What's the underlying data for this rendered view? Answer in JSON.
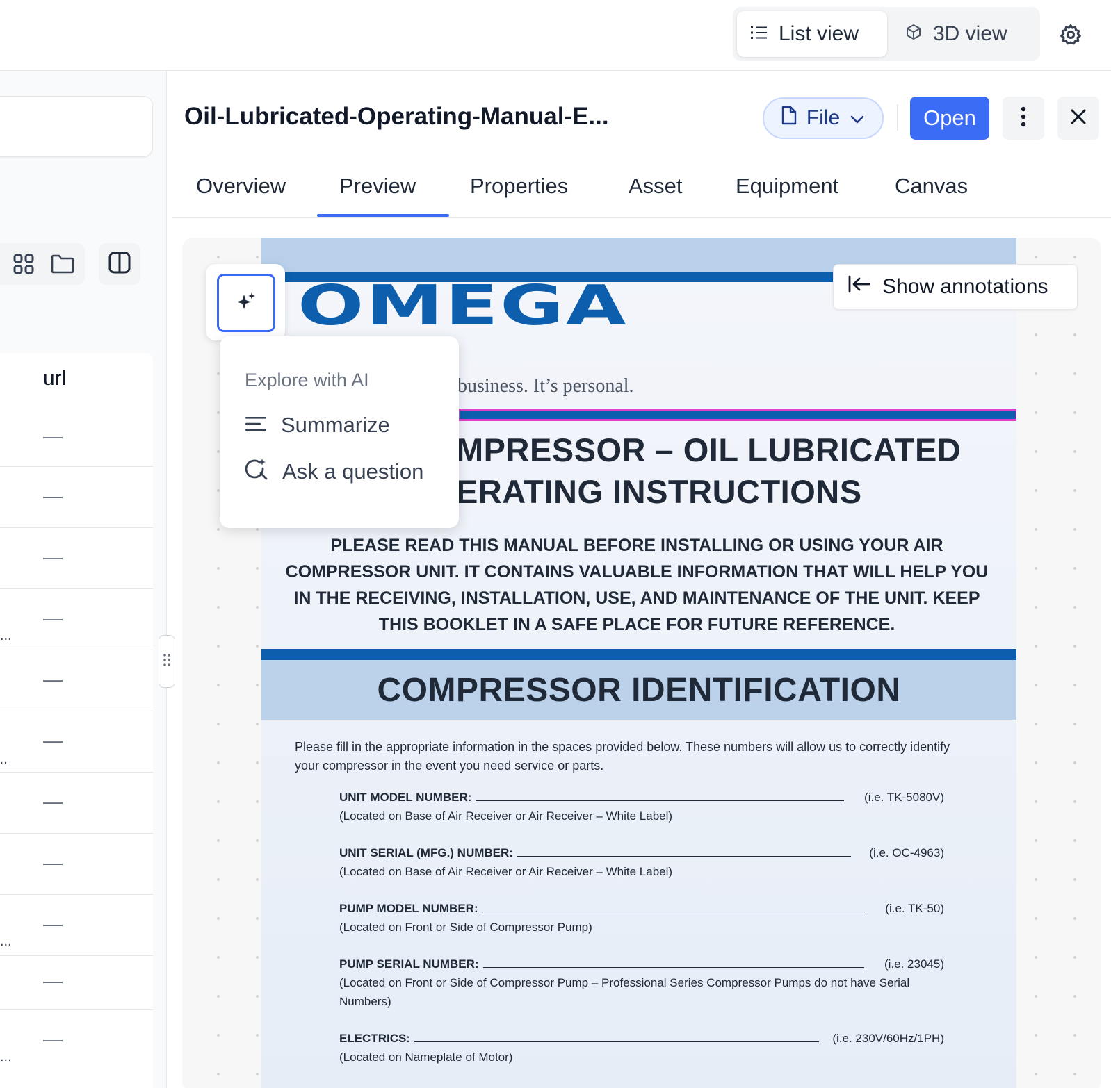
{
  "topbar": {
    "list_view_label": "List view",
    "view3d_label": "3D view"
  },
  "left_panel": {
    "column_header": "url",
    "rows": [
      "—",
      "—",
      "—",
      "—",
      "—",
      "—",
      "—",
      "—",
      "—",
      "—",
      "—"
    ],
    "truncation": "..."
  },
  "document": {
    "title": "Oil-Lubricated-Operating-Manual-E...",
    "file_label": "File",
    "open_label": "Open"
  },
  "tabs": [
    {
      "label": "Overview"
    },
    {
      "label": "Preview"
    },
    {
      "label": "Properties"
    },
    {
      "label": "Asset"
    },
    {
      "label": "Equipment"
    },
    {
      "label": "Canvas"
    }
  ],
  "active_tab": "Preview",
  "ai_menu": {
    "heading": "Explore with AI",
    "summarize": "Summarize",
    "ask": "Ask a question"
  },
  "annotations_label": "Show annotations",
  "manual": {
    "logo": "OMEGA",
    "tagline": "business. It’s personal.",
    "heading_line1": "MPRESSOR – OIL LUBRICATED",
    "heading_line2": "ERATING INSTRUCTIONS",
    "notice": "PLEASE READ THIS MANUAL BEFORE INSTALLING OR USING YOUR AIR COMPRESSOR UNIT. IT CONTAINS VALUABLE INFORMATION THAT WILL HELP YOU IN THE RECEIVING, INSTALLATION, USE, AND MAINTENANCE OF THE UNIT. KEEP THIS BOOKLET IN A SAFE PLACE FOR FUTURE REFERENCE.",
    "section_title": "COMPRESSOR IDENTIFICATION",
    "intro": "Please fill in the appropriate information in the spaces provided below. These numbers will allow us to correctly identify your compressor in the event you need service or parts.",
    "fields": [
      {
        "label": "UNIT MODEL NUMBER:",
        "example": "(i.e. TK-5080V)",
        "note": "(Located on Base of Air Receiver or Air Receiver – White Label)"
      },
      {
        "label": "UNIT SERIAL (MFG.) NUMBER:",
        "example": "(i.e. OC-4963)",
        "note": "(Located on Base of Air Receiver or Air Receiver – White Label)"
      },
      {
        "label": "PUMP MODEL NUMBER:",
        "example": "(i.e. TK-50)",
        "note": "(Located on Front or Side of Compressor Pump)"
      },
      {
        "label": "PUMP SERIAL NUMBER:",
        "example": "(i.e.  23045)",
        "note": "(Located on Front or Side of Compressor Pump – Professional Series Compressor Pumps do not have Serial Numbers)"
      },
      {
        "label": "ELECTRICS:",
        "example": "(i.e. 230V/60Hz/1PH)",
        "note": "(Located on Nameplate of Motor)"
      }
    ]
  },
  "colors": {
    "accent": "#3b6cf6",
    "omega_blue": "#0d5fad",
    "band_blue": "#bcd2ea",
    "annotation_pink": "#e040c8"
  }
}
